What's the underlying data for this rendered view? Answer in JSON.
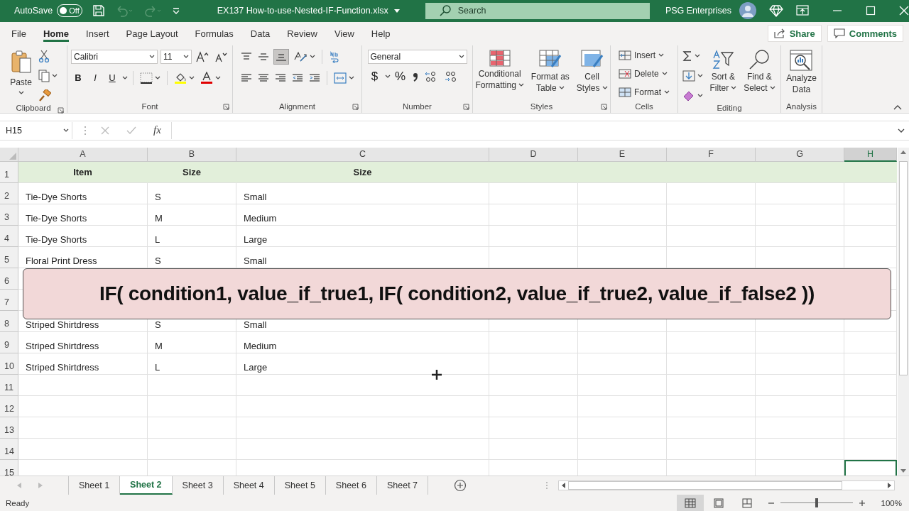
{
  "title_bar": {
    "autosave_label": "AutoSave",
    "autosave_on": false,
    "autosave_state": "Off",
    "file_name": "EX137 How-to-use-Nested-IF-Function.xlsx",
    "search_placeholder": "Search",
    "user_name": "PSG Enterprises"
  },
  "menu_tabs": [
    {
      "label": "File",
      "selected": false
    },
    {
      "label": "Home",
      "selected": true
    },
    {
      "label": "Insert",
      "selected": false
    },
    {
      "label": "Page Layout",
      "selected": false
    },
    {
      "label": "Formulas",
      "selected": false
    },
    {
      "label": "Data",
      "selected": false
    },
    {
      "label": "Review",
      "selected": false
    },
    {
      "label": "View",
      "selected": false
    },
    {
      "label": "Help",
      "selected": false
    }
  ],
  "share": "Share",
  "comments": "Comments",
  "ribbon": {
    "clipboard": {
      "paste": "Paste",
      "label": "Clipboard"
    },
    "font": {
      "name": "Calibri",
      "size": "11",
      "style_buttons": [
        "B",
        "I",
        "U"
      ],
      "label": "Font"
    },
    "alignment": {
      "label": "Alignment"
    },
    "number": {
      "format": "General",
      "currency": "$",
      "percent": "%",
      "label": "Number"
    },
    "styles": {
      "buttons": [
        [
          "Conditional",
          "Formatting"
        ],
        [
          "Format as",
          "Table"
        ],
        [
          "Cell",
          "Styles"
        ]
      ],
      "label": "Styles"
    },
    "cells": {
      "buttons": [
        "Insert",
        "Delete",
        "Format"
      ],
      "label": "Cells"
    },
    "editing": {
      "buttons": [
        [
          "Sort &",
          "Filter"
        ],
        [
          "Find &",
          "Select"
        ]
      ],
      "label": "Editing"
    },
    "analysis": {
      "button": [
        "Analyze",
        "Data"
      ],
      "label": "Analysis"
    }
  },
  "formula_bar": {
    "name_box": "H15",
    "function_label": "fx"
  },
  "sheet": {
    "columns": [
      {
        "label": "A",
        "selected": false
      },
      {
        "label": "B",
        "selected": false
      },
      {
        "label": "C",
        "selected": false
      },
      {
        "label": "D",
        "selected": false
      },
      {
        "label": "E",
        "selected": false
      },
      {
        "label": "F",
        "selected": false
      },
      {
        "label": "G",
        "selected": false
      },
      {
        "label": "H",
        "selected": true
      }
    ],
    "rows": [
      {
        "number": "1",
        "kind": "header",
        "cells": [
          "Item",
          "Size",
          "Size"
        ]
      },
      {
        "number": "2",
        "kind": "data",
        "cells": [
          "Tie-Dye Shorts",
          "S",
          "Small"
        ]
      },
      {
        "number": "3",
        "kind": "data",
        "cells": [
          "Tie-Dye Shorts",
          "M",
          "Medium"
        ]
      },
      {
        "number": "4",
        "kind": "data",
        "cells": [
          "Tie-Dye Shorts",
          "L",
          "Large"
        ]
      },
      {
        "number": "5",
        "kind": "data",
        "cells": [
          "Floral Print Dress",
          "S",
          "Small"
        ]
      },
      {
        "number": "6",
        "kind": "data"
      },
      {
        "number": "7",
        "kind": "data"
      },
      {
        "number": "8",
        "kind": "data",
        "cells": [
          "Striped Shirtdress",
          "S",
          "Small"
        ]
      },
      {
        "number": "9",
        "kind": "data",
        "cells": [
          "Striped Shirtdress",
          "M",
          "Medium"
        ]
      },
      {
        "number": "10",
        "kind": "data",
        "cells": [
          "Striped Shirtdress",
          "L",
          "Large"
        ]
      },
      {
        "number": "11",
        "kind": "data"
      },
      {
        "number": "12",
        "kind": "data"
      },
      {
        "number": "13",
        "kind": "data"
      },
      {
        "number": "14",
        "kind": "data"
      },
      {
        "number": "15",
        "kind": "data"
      }
    ]
  },
  "overlay": {
    "text": "IF( condition1, value_if_true1, IF( condition2, value_if_true2, value_if_false2 ))"
  },
  "sheet_tabs": [
    {
      "label": "Sheet 1",
      "selected": false
    },
    {
      "label": "Sheet 2",
      "selected": true
    },
    {
      "label": "Sheet 3",
      "selected": false
    },
    {
      "label": "Sheet 4",
      "selected": false
    },
    {
      "label": "Sheet 5",
      "selected": false
    },
    {
      "label": "Sheet 6",
      "selected": false
    },
    {
      "label": "Sheet 7",
      "selected": false
    }
  ],
  "status_bar": {
    "status": "Ready",
    "zoom": "100%",
    "zoom_level": {
      "level": 0.5
    }
  }
}
